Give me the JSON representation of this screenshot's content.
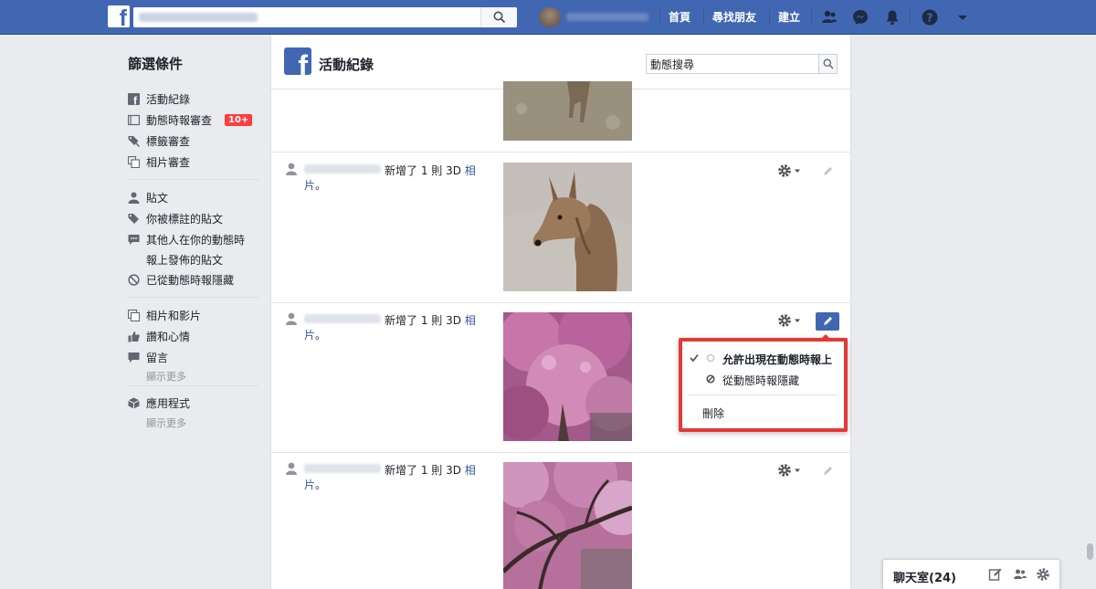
{
  "topbar": {
    "logo_letter": "f",
    "search_placeholder": "",
    "nav": [
      "首頁",
      "尋找朋友",
      "建立"
    ],
    "icons": [
      "friends-icon",
      "messenger-icon",
      "notifications-icon",
      "help-icon",
      "menu-caret-icon"
    ]
  },
  "sidebar": {
    "title": "篩選條件",
    "group1": [
      {
        "label": "活動紀錄",
        "icon": "activity-log-icon"
      },
      {
        "label": "動態時報審查",
        "icon": "timeline-review-icon",
        "badge": "10+"
      },
      {
        "label": "標籤審查",
        "icon": "tag-review-icon"
      },
      {
        "label": "相片審查",
        "icon": "photo-review-icon"
      }
    ],
    "group2": [
      {
        "label": "貼文",
        "icon": "person-icon"
      },
      {
        "label": "你被標註的貼文",
        "icon": "tag-icon"
      },
      {
        "label": "其他人在你的動態時",
        "icon": "comment-icon"
      },
      {
        "label": "報上發佈的貼文",
        "icon": ""
      },
      {
        "label": "已從動態時報隱藏",
        "icon": "hidden-icon"
      }
    ],
    "group3": [
      {
        "label": "相片和影片",
        "icon": "photos-icon"
      },
      {
        "label": "讚和心情",
        "icon": "like-icon"
      },
      {
        "label": "留言",
        "icon": "comment-icon"
      }
    ],
    "show_more": "顯示更多",
    "group4": [
      {
        "label": "應用程式",
        "icon": "apps-icon"
      }
    ]
  },
  "main": {
    "title": "活動紀錄",
    "search_value": "動態搜尋",
    "rows": [
      {
        "text": "新增了 1 則 3D ",
        "link": "相片",
        "suffix": "。"
      },
      {
        "text": "新增了 1 則 3D ",
        "link": "相片",
        "suffix": "。"
      },
      {
        "text": "新增了 1 則 3D ",
        "link": "相片",
        "suffix": "。"
      }
    ]
  },
  "dropdown": {
    "allow": "允許出現在動態時報上",
    "hide": "從動態時報隱藏",
    "delete": "刪除"
  },
  "chat": {
    "label": "聊天室(24)"
  },
  "colors": {
    "brand": "#4267b2",
    "highlight": "#e53935",
    "badge": "#fa3e3e",
    "link": "#365899"
  }
}
